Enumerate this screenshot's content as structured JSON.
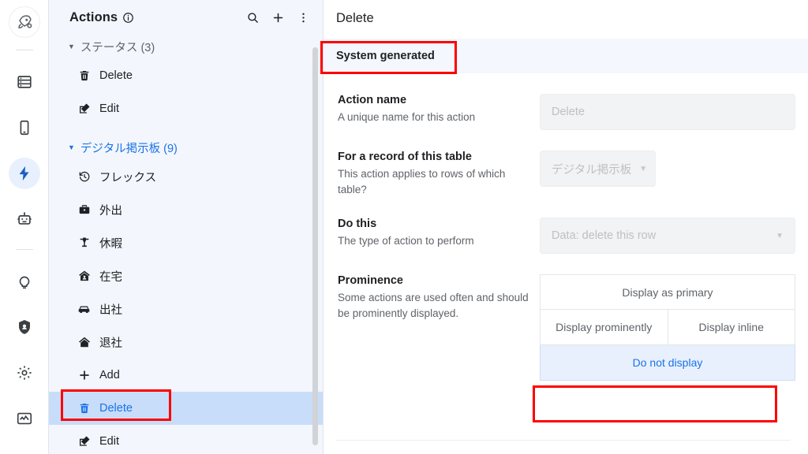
{
  "rail": {
    "logo": {
      "name": "rocket-logo-icon"
    },
    "items": [
      {
        "name": "nav-data-icon",
        "icon": "database",
        "active": false
      },
      {
        "name": "nav-apps-icon",
        "icon": "mobile",
        "active": false
      },
      {
        "name": "nav-actions-icon",
        "icon": "bolt",
        "active": true
      },
      {
        "name": "nav-automation-icon",
        "icon": "robot",
        "active": false
      },
      {
        "name": "nav-intelligence-icon",
        "icon": "bulb",
        "active": false
      },
      {
        "name": "nav-security-icon",
        "icon": "shield",
        "active": false
      },
      {
        "name": "nav-settings-icon",
        "icon": "gear",
        "active": false
      },
      {
        "name": "nav-monitor-icon",
        "icon": "monitor",
        "active": false
      }
    ]
  },
  "panel": {
    "title": "Actions",
    "info_icon": "info-icon",
    "search_icon": "search-icon",
    "add_icon": "plus-icon",
    "more_icon": "more-vertical-icon",
    "groups": [
      {
        "label": "ステータス (3)",
        "color": "#5f6368",
        "caret": "▼",
        "items": [
          {
            "label": "Delete",
            "icon": "trash-icon",
            "selected": false
          },
          {
            "label": "Edit",
            "icon": "edit-icon",
            "selected": false
          }
        ]
      },
      {
        "label": "デジタル掲示板 (9)",
        "color": "#1a73e8",
        "caret": "▼",
        "items": [
          {
            "label": "フレックス",
            "icon": "history-icon",
            "selected": false
          },
          {
            "label": "外出",
            "icon": "briefcase-icon",
            "selected": false
          },
          {
            "label": "休暇",
            "icon": "palm-tree-icon",
            "selected": false
          },
          {
            "label": "在宅",
            "icon": "home-work-icon",
            "selected": false
          },
          {
            "label": "出社",
            "icon": "car-icon",
            "selected": false
          },
          {
            "label": "退社",
            "icon": "house-icon",
            "selected": false
          },
          {
            "label": "Add",
            "icon": "plus-icon",
            "selected": false
          },
          {
            "label": "Delete",
            "icon": "trash-icon",
            "selected": true
          },
          {
            "label": "Edit",
            "icon": "edit-icon",
            "selected": false
          }
        ]
      }
    ]
  },
  "detail": {
    "title": "Delete",
    "tab_label": "System generated",
    "fields": {
      "action_name": {
        "label": "Action name",
        "description": "A unique name for this action",
        "value": "Delete"
      },
      "record_table": {
        "label": "For a record of this table",
        "description": "This action applies to rows of which table?",
        "value": "デジタル掲示板",
        "caret": "▼"
      },
      "do_this": {
        "label": "Do this",
        "description": "The type of action to perform",
        "value": "Data: delete this row",
        "caret": "▼"
      },
      "prominence": {
        "label": "Prominence",
        "description": "Some actions are used often and should be prominently displayed.",
        "options": [
          {
            "label": "Display as primary",
            "selected": false
          },
          {
            "label": "Display prominently",
            "selected": false
          },
          {
            "label": "Display inline",
            "selected": false
          },
          {
            "label": "Do not display",
            "selected": true
          }
        ]
      }
    }
  },
  "colors": {
    "accent": "#1a73e8",
    "annotation": "#fe0000",
    "panel_bg": "#f3f6fc",
    "selected_item_bg": "#c8ddf9",
    "selected_option_bg": "#e8f0fe"
  }
}
